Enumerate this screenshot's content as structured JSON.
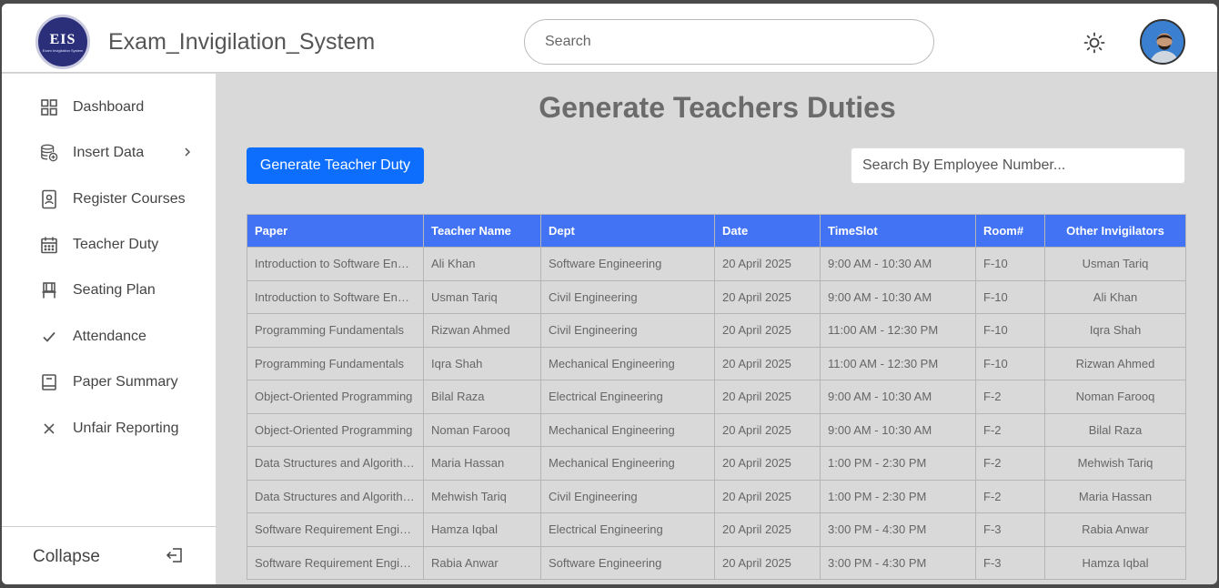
{
  "header": {
    "logo_text": "EIS",
    "logo_subtext": "Exam Invigilation System",
    "app_title": "Exam_Invigilation_System",
    "search_placeholder": "Search"
  },
  "sidebar": {
    "items": [
      {
        "label": "Dashboard",
        "icon": "dashboard-grid-icon"
      },
      {
        "label": "Insert Data",
        "icon": "database-add-icon",
        "has_submenu": true
      },
      {
        "label": "Register Courses",
        "icon": "id-badge-icon"
      },
      {
        "label": "Teacher Duty",
        "icon": "calendar-icon"
      },
      {
        "label": "Seating Plan",
        "icon": "chair-icon"
      },
      {
        "label": "Attendance",
        "icon": "check-icon"
      },
      {
        "label": "Paper Summary",
        "icon": "book-icon"
      },
      {
        "label": "Unfair Reporting",
        "icon": "close-icon"
      }
    ],
    "collapse_label": "Collapse"
  },
  "main": {
    "title": "Generate Teachers Duties",
    "generate_button": "Generate Teacher Duty",
    "employee_search_placeholder": "Search By Employee Number...",
    "table": {
      "headers": [
        "Paper",
        "Teacher Name",
        "Dept",
        "Date",
        "TimeSlot",
        "Room#",
        "Other Invigilators"
      ],
      "rows": [
        [
          "Introduction to Software Engi...",
          "Ali Khan",
          "Software Engineering",
          "20 April 2025",
          "9:00 AM - 10:30 AM",
          "F-10",
          "Usman Tariq"
        ],
        [
          "Introduction to Software Engi...",
          "Usman Tariq",
          "Civil Engineering",
          "20 April 2025",
          "9:00 AM - 10:30 AM",
          "F-10",
          "Ali Khan"
        ],
        [
          "Programming Fundamentals",
          "Rizwan Ahmed",
          "Civil Engineering",
          "20 April 2025",
          "11:00 AM - 12:30 PM",
          "F-10",
          "Iqra Shah"
        ],
        [
          "Programming Fundamentals",
          "Iqra Shah",
          "Mechanical Engineering",
          "20 April 2025",
          "11:00 AM - 12:30 PM",
          "F-10",
          "Rizwan Ahmed"
        ],
        [
          "Object-Oriented Programming",
          "Bilal Raza",
          "Electrical Engineering",
          "20 April 2025",
          "9:00 AM - 10:30 AM",
          "F-2",
          "Noman Farooq"
        ],
        [
          "Object-Oriented Programming",
          "Noman Farooq",
          "Mechanical Engineering",
          "20 April 2025",
          "9:00 AM - 10:30 AM",
          "F-2",
          "Bilal Raza"
        ],
        [
          "Data Structures and Algorithms",
          "Maria Hassan",
          "Mechanical Engineering",
          "20 April 2025",
          "1:00 PM - 2:30 PM",
          "F-2",
          "Mehwish Tariq"
        ],
        [
          "Data Structures and Algorithms",
          "Mehwish Tariq",
          "Civil Engineering",
          "20 April 2025",
          "1:00 PM - 2:30 PM",
          "F-2",
          "Maria Hassan"
        ],
        [
          "Software Requirement Engine...",
          "Hamza Iqbal",
          "Electrical Engineering",
          "20 April 2025",
          "3:00 PM - 4:30 PM",
          "F-3",
          "Rabia Anwar"
        ],
        [
          "Software Requirement Engine...",
          "Rabia Anwar",
          "Software Engineering",
          "20 April 2025",
          "3:00 PM - 4:30 PM",
          "F-3",
          "Hamza Iqbal"
        ]
      ]
    }
  },
  "colors": {
    "accent": "#0d6efd",
    "table_header": "#4273f4",
    "content_bg": "#d9d9d9"
  }
}
